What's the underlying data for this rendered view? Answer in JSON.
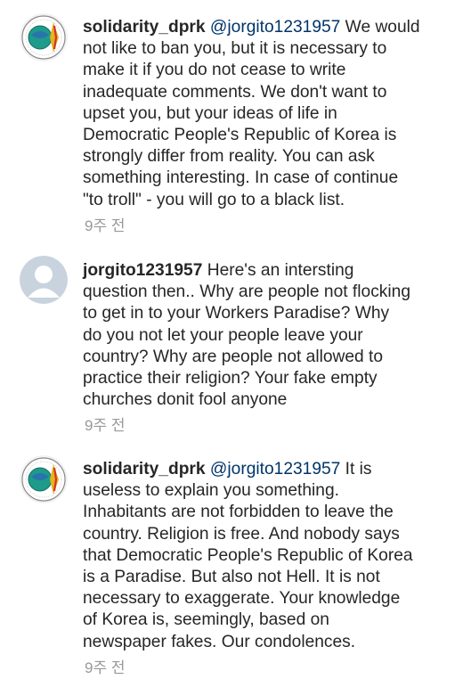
{
  "comments": [
    {
      "username": "solidarity_dprk",
      "mention": "@jorgito1231957",
      "text": " We would\nnot like to ban you, but it is necessary to\nmake it if you do not cease to write\ninadequate comments. We don't want to\nupset you, but your ideas of life in\nDemocratic People's Republic of Korea is\nstrongly differ from reality. You can ask\nsomething interesting. In case of continue\n\"to troll\" - you will go to a black list.",
      "time": "9주 전",
      "avatar": "dprk-emblem-icon"
    },
    {
      "username": "jorgito1231957",
      "mention": "",
      "text": " Here's an intersting\nquestion then.. Why are people not flocking\nto get in to your Workers Paradise?  Why\ndo you not let your people leave your\ncountry?  Why are people not allowed to\npractice their religion?  Your fake empty\nchurches donit fool anyone",
      "time": "9주 전",
      "avatar": "default-user-icon"
    },
    {
      "username": "solidarity_dprk",
      "mention": "@jorgito1231957",
      "text": " It is\nuseless  to explain you something.\nInhabitants are not forbidden to leave the\ncountry. Religion is free. And nobody says\nthat Democratic People's Republic of Korea\nis a Paradise. But also not Hell. It is not\nnecessary to exaggerate. Your knowledge\nof Korea is, seemingly, based on\nnewspaper fakes. Our condolences.",
      "time": "9주 전",
      "avatar": "dprk-emblem-icon"
    }
  ]
}
